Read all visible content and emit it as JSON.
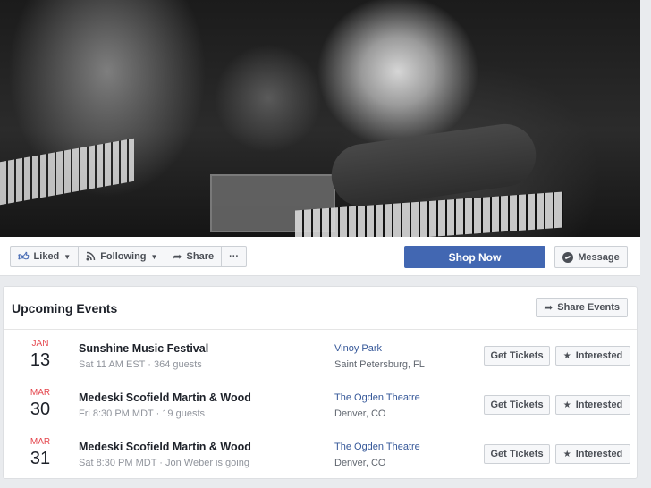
{
  "cover": {
    "alt": "Black and white concert photo of a band performing"
  },
  "actions": {
    "liked_label": "Liked",
    "following_label": "Following",
    "share_label": "Share",
    "more_label": "···",
    "shop_label": "Shop Now",
    "message_label": "Message"
  },
  "events_card": {
    "title": "Upcoming Events",
    "share_events_label": "Share Events",
    "get_tickets_label": "Get Tickets",
    "interested_label": "Interested",
    "events": [
      {
        "month": "JAN",
        "day": "13",
        "name": "Sunshine Music Festival",
        "meta": "Sat 11 AM EST · 364 guests",
        "place": "Vinoy Park",
        "city": "Saint Petersburg, FL"
      },
      {
        "month": "MAR",
        "day": "30",
        "name": "Medeski Scofield Martin & Wood",
        "meta": "Fri 8:30 PM MDT · 19 guests",
        "place": "The Ogden Theatre",
        "city": "Denver, CO"
      },
      {
        "month": "MAR",
        "day": "31",
        "name": "Medeski Scofield Martin & Wood",
        "meta": "Sat 8:30 PM MDT · Jon Weber is going",
        "place": "The Ogden Theatre",
        "city": "Denver, CO"
      }
    ]
  },
  "colors": {
    "brand_blue": "#4267b2",
    "date_red": "#e4464d",
    "link_blue": "#365899",
    "page_bg": "#e9ebee"
  },
  "icons": [
    "thumbs-up-icon",
    "rss-icon",
    "share-arrow-icon",
    "ellipsis-icon",
    "message-bubble-icon",
    "star-icon",
    "chevron-down-icon"
  ]
}
